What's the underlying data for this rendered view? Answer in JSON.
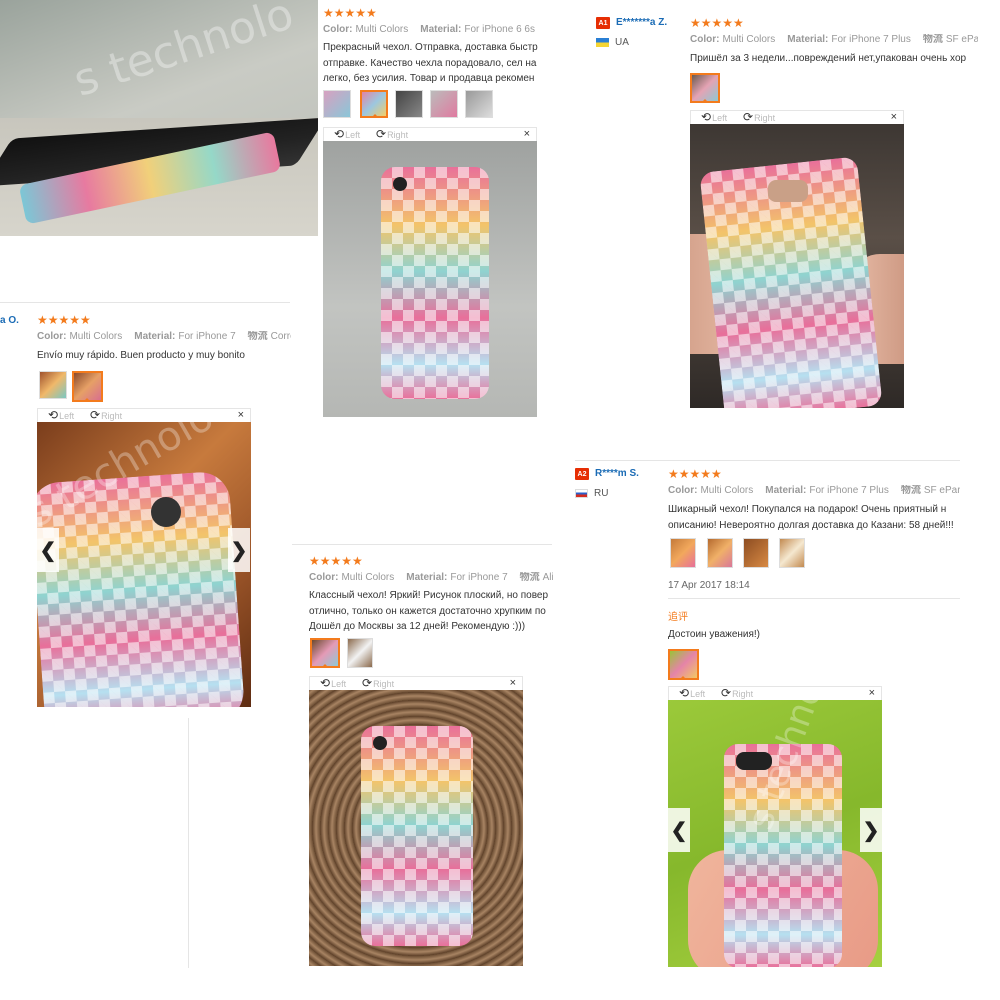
{
  "watermark": "s technolo",
  "review1": {
    "stars": "★★★★★",
    "color_label": "Color:",
    "color_value": "Multi Colors",
    "material_label": "Material:",
    "material_value": "For iPhone 6 6s",
    "text_lines": [
      "Прекрасный чехол. Отправка, доставка быстр",
      "отправке. Качество чехла порадовало, сел на",
      "легко, без усилия. Товар и продавца рекомен"
    ],
    "rotate_left": "Left",
    "rotate_right": "Right",
    "close": "×"
  },
  "review2": {
    "avatar": "A1",
    "user": "E*******a Z.",
    "country": "UA",
    "stars": "★★★★★",
    "color_label": "Color:",
    "color_value": "Multi Colors",
    "material_label": "Material:",
    "material_value": "For iPhone 7 Plus",
    "shipping_label": "物流",
    "shipping_value": "SF eParc",
    "text_lines": [
      "Пришёл за 3 недели...повреждений нет,упакован очень хор"
    ],
    "rotate_left": "Left",
    "rotate_right": "Right",
    "close": "×"
  },
  "review3": {
    "user": "a O.",
    "stars": "★★★★★",
    "color_label": "Color:",
    "color_value": "Multi Colors",
    "material_label": "Material:",
    "material_value": "For iPhone 7",
    "shipping_label": "物流",
    "shipping_value": "Correo",
    "text_lines": [
      "Envío muy rápido. Buen producto y muy bonito"
    ],
    "rotate_left": "Left",
    "rotate_right": "Right",
    "close": "×",
    "prev": "❮",
    "next": "❯"
  },
  "review4": {
    "stars": "★★★★★",
    "color_label": "Color:",
    "color_value": "Multi Colors",
    "material_label": "Material:",
    "material_value": "For iPhone 7",
    "shipping_label": "物流",
    "shipping_value": "AliE",
    "text_lines": [
      "Классный чехол! Яркий! Рисунок плоский, но повер",
      "отлично, только он кажется достаточно хрупким по",
      "Дошёл до Москвы за 12 дней! Рекомендую :)))"
    ],
    "rotate_left": "Left",
    "rotate_right": "Right",
    "close": "×"
  },
  "review5": {
    "avatar": "A2",
    "user": "R****m S.",
    "country": "RU",
    "stars": "★★★★★",
    "color_label": "Color:",
    "color_value": "Multi Colors",
    "material_label": "Material:",
    "material_value": "For iPhone 7 Plus",
    "shipping_label": "物流",
    "shipping_value": "SF eParce",
    "text_lines": [
      "Шикарный чехол! Покупался на подарок! Очень приятный н",
      "описанию! Невероятно долгая доставка до Казани: 58 дней!!!"
    ],
    "date": "17 Apr 2017 18:14",
    "followup_label": "追评",
    "followup_text": "Достоин уважения!)",
    "rotate_left": "Left",
    "rotate_right": "Right",
    "close": "×",
    "prev": "❮",
    "next": "❯"
  },
  "colors": {
    "accent": "#f37b1d",
    "username": "#1a6bb5",
    "avatar": "#e62e04"
  }
}
